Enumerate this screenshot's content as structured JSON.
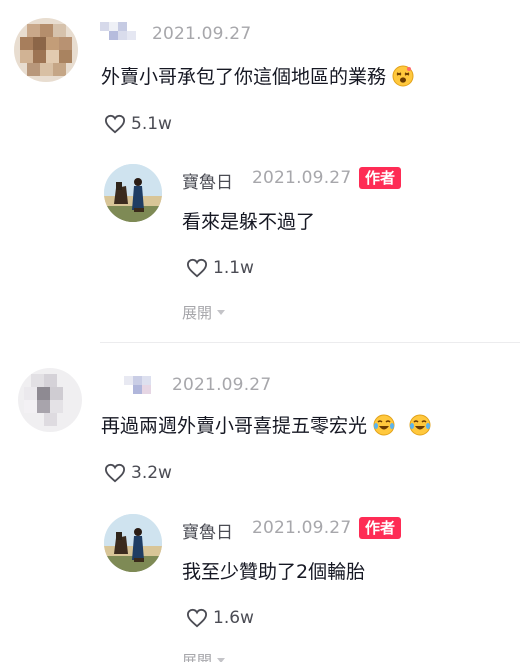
{
  "comments": [
    {
      "date": "2021.09.27",
      "text": "外賣小哥承包了你這個地區的業務",
      "likes": "5.1w",
      "reply": {
        "name": "寶魯日",
        "date": "2021.09.27",
        "badge": "作者",
        "text": "看來是躲不過了",
        "likes": "1.1w",
        "expand": "展開"
      }
    },
    {
      "date": "2021.09.27",
      "text": "再過兩週外賣小哥喜提五零宏光",
      "likes": "3.2w",
      "reply": {
        "name": "寶魯日",
        "date": "2021.09.27",
        "badge": "作者",
        "text": "我至少贊助了2個輪胎",
        "likes": "1.6w",
        "expand": "展開"
      }
    }
  ],
  "colors": {
    "accent": "#fe2c55",
    "meta": "#a7a7ab",
    "text": "#161823"
  },
  "icons": {
    "like": "heart-outline-icon",
    "expand": "caret-down-icon",
    "emoji_1": "dizzy-face-emoji-icon",
    "emoji_2": "crying-laughing-emoji-icon"
  }
}
